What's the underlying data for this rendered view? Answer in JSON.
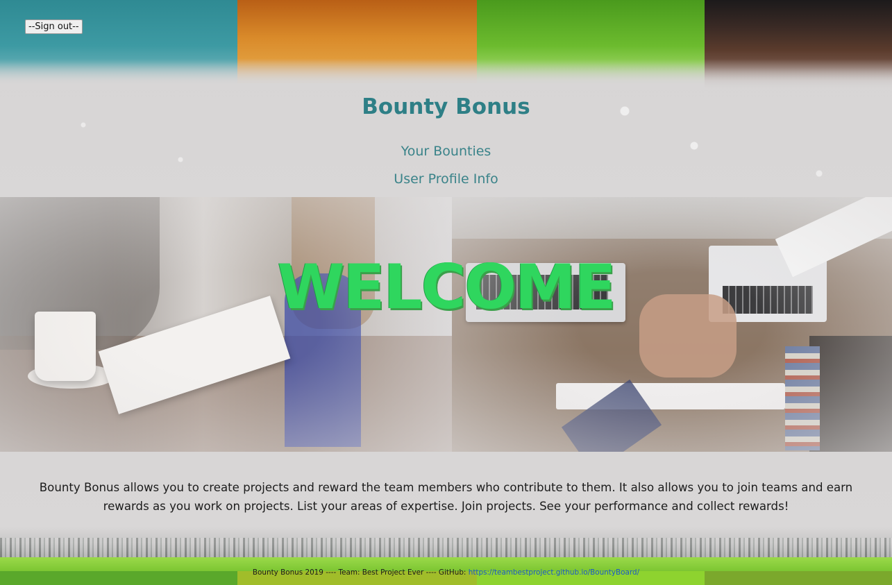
{
  "header": {
    "signout_label": "--Sign out--",
    "title": "Bounty Bonus",
    "nav": {
      "bounties": "Your Bounties",
      "profile": "User Profile Info"
    }
  },
  "hero": {
    "welcome": "WELCOME"
  },
  "main": {
    "description": "Bounty Bonus allows you to create projects and reward the team members who contribute to them. It also allows you to join teams and earn rewards as you work on projects. List your areas of expertise. Join projects. See your performance and collect rewards!"
  },
  "footer": {
    "text": "Bounty Bonus 2019 ---- Team: Best Project Ever ---- GitHub: ",
    "link_text": "https://teambestproject.github.io/BountyBoard/"
  },
  "colors": {
    "title": "#2e7f86",
    "welcome": "#2fd65e",
    "link": "#1a57c9",
    "band_teal": "#2f8a93",
    "band_orange": "#d98a2a",
    "band_green": "#6cbb2e",
    "band_brown": "#3a2a25"
  }
}
